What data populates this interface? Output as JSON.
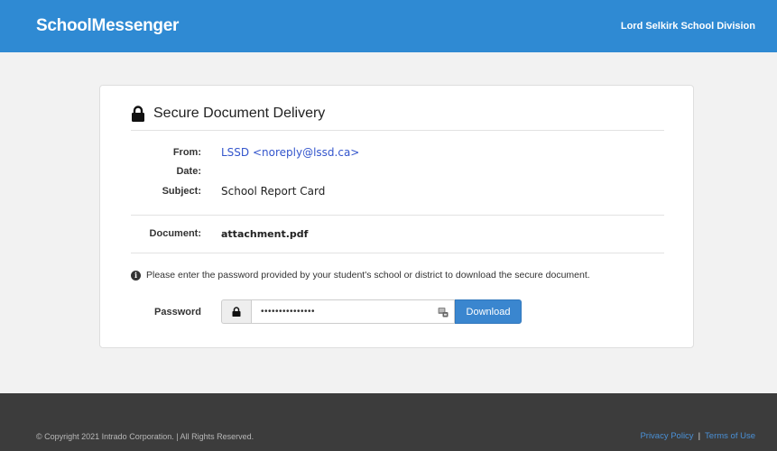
{
  "header": {
    "brand": "SchoolMessenger",
    "district": "Lord Selkirk School Division"
  },
  "card": {
    "title": "Secure Document Delivery",
    "from_label": "From:",
    "from_value": "LSSD <noreply@lssd.ca>",
    "date_label": "Date:",
    "date_value": "",
    "subject_label": "Subject:",
    "subject_value": "School Report Card",
    "document_label": "Document:",
    "document_value": "attachment.pdf",
    "info_text": "Please enter the password provided by your student's school or district to download the secure document.",
    "password_label": "Password",
    "password_value": "•••••••••••••••",
    "download_label": "Download"
  },
  "footer": {
    "copyright": "© Copyright 2021 Intrado Corporation.  |  All Rights Reserved.",
    "privacy": "Privacy Policy",
    "separator": "|",
    "terms": "Terms of Use"
  }
}
